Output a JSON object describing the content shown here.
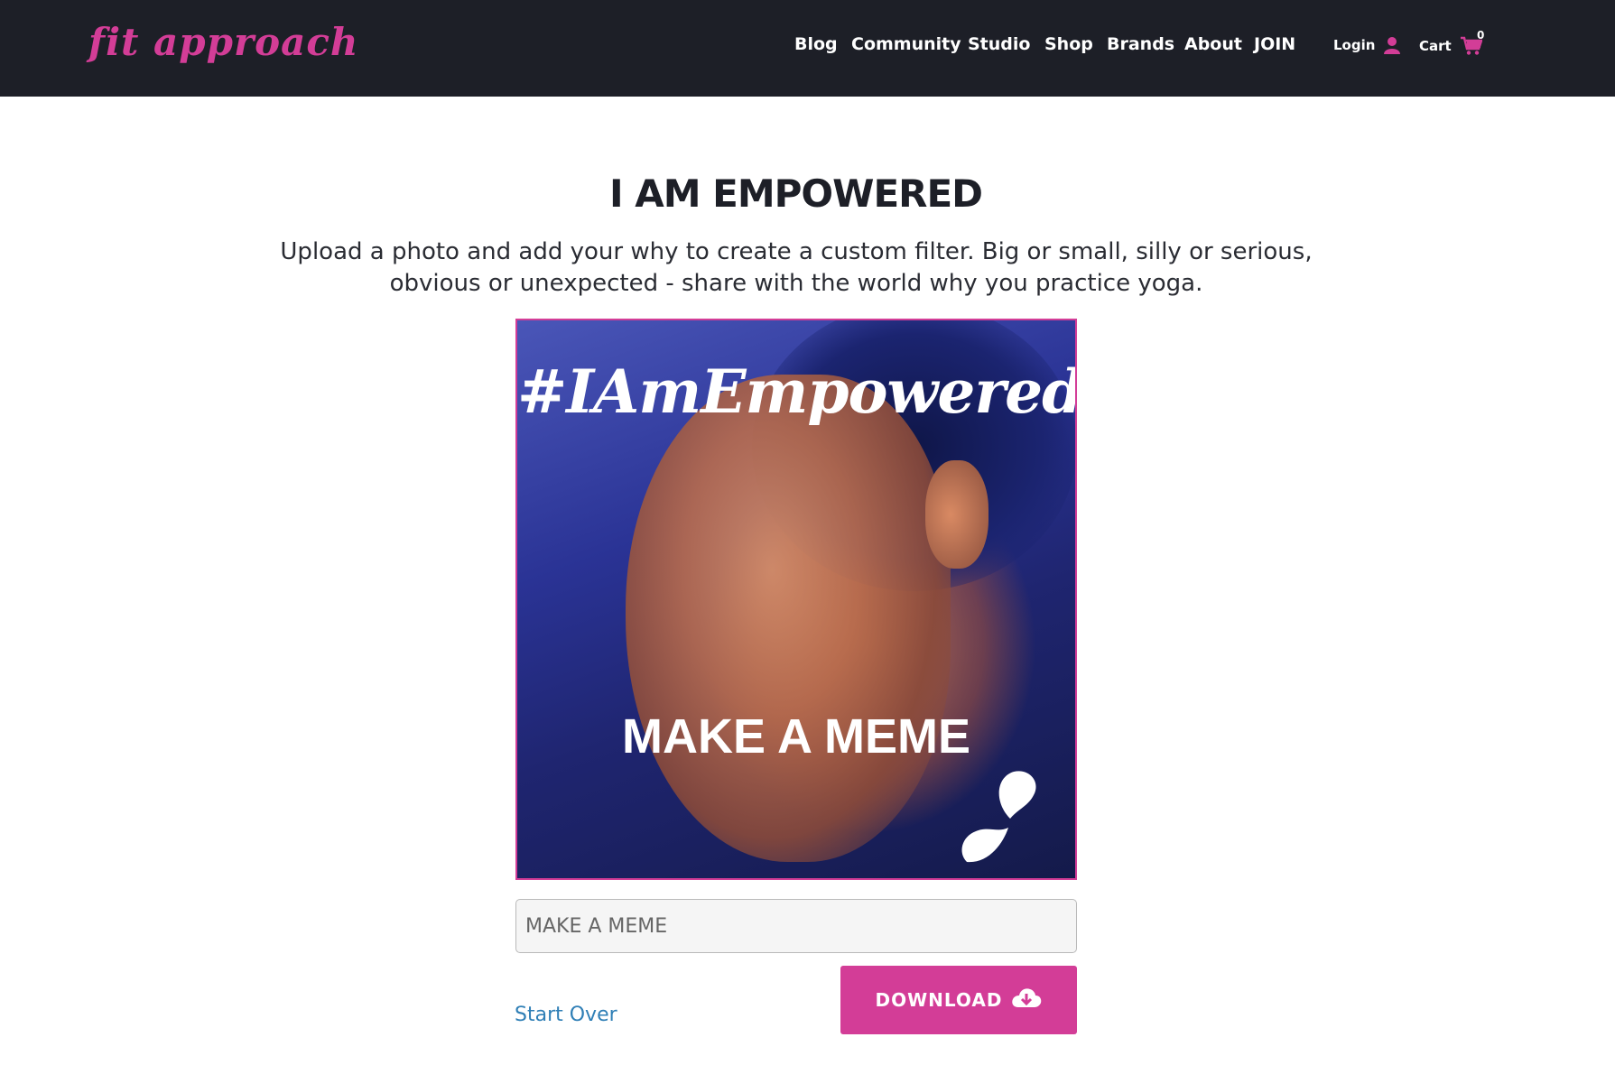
{
  "header": {
    "logo_text": "fit approach",
    "nav": {
      "blog": "Blog",
      "community": "Community",
      "studio": "Studio",
      "shop": "Shop",
      "brands": "Brands",
      "about": "About",
      "join": "JOIN",
      "login": "Login",
      "cart": "Cart",
      "cart_count": "0"
    }
  },
  "main": {
    "title": "I AM EMPOWERED",
    "subtitle": "Upload a photo and add your why to create a custom filter. Big or small, silly or serious, obvious or unexpected - share with the world why you practice yoga.",
    "photo": {
      "hashtag": "#IAmEmpowered",
      "caption": "MAKE A MEME"
    },
    "meme_input": {
      "placeholder": "MAKE A MEME",
      "value": ""
    },
    "start_over_label": "Start Over",
    "download_label": "DOWNLOAD"
  },
  "colors": {
    "brand_pink": "#d33d97",
    "header_bg": "#1d1f27",
    "link_blue": "#2f7fb6"
  },
  "icons": {
    "login": "user-icon",
    "cart": "shopping-cart-icon",
    "download": "cloud-download-icon",
    "watermark": "droplets-icon"
  }
}
